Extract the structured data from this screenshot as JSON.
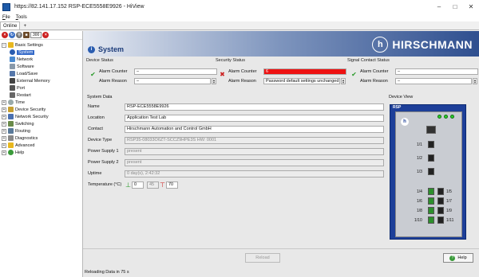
{
  "window": {
    "title": "https://82.141.17.152 RSP-ECE5558E9926 - HiView",
    "min": "–",
    "max": "□",
    "close": "✕"
  },
  "menu": {
    "file_key": "F",
    "file_rest": "ile",
    "tools_key": "T",
    "tools_rest": "ools"
  },
  "tabs": {
    "online": "Online",
    "add": "+"
  },
  "toolbar": {
    "counter": "300"
  },
  "tree": {
    "basic_settings": "Basic Settings",
    "system": "System",
    "network": "Network",
    "software": "Software",
    "load_save": "Load/Save",
    "external_memory": "External Memory",
    "port": "Port",
    "restart": "Restart",
    "time": "Time",
    "device_security": "Device Security",
    "network_security": "Network Security",
    "switching": "Switching",
    "routing": "Routing",
    "diagnostics": "Diagnostics",
    "advanced": "Advanced",
    "help": "Help",
    "expand_plus": "+",
    "expand_minus": "−"
  },
  "header": {
    "title": "System",
    "brand_name": "HIRSCHMANN",
    "brand_logo": "h"
  },
  "device_status": {
    "title": "Device Status",
    "alarm_counter_label": "Alarm Counter",
    "alarm_counter": "–",
    "alarm_reason_label": "Alarm Reason",
    "alarm_reason": "–"
  },
  "security_status": {
    "title": "Security Status",
    "alarm_counter_label": "Alarm Counter",
    "alarm_counter": "6",
    "alarm_reason_label": "Alarm Reason",
    "alarm_reason": "Password default settings unchanged ("
  },
  "signal_status": {
    "title": "Signal Contact Status",
    "alarm_counter_label": "Alarm Counter",
    "alarm_counter": "–",
    "alarm_reason_label": "Alarm Reason",
    "alarm_reason": "–"
  },
  "system_data": {
    "title": "System Data",
    "name_label": "Name",
    "name": "RSP-ECE5558E9926",
    "location_label": "Location",
    "location": "Application Test Lab",
    "contact_label": "Contact",
    "contact": "Hirschmann Automation and Control GmbH",
    "device_type_label": "Device Type",
    "device_type": "RSP35-08033O6ZT-SCCZ9HPE3S HW: 0001",
    "ps1_label": "Power Supply 1",
    "ps1": "present",
    "ps2_label": "Power Supply 2",
    "ps2": "present",
    "uptime_label": "Uptime",
    "uptime": "0 day(s), 2:42:32",
    "temperature_label": "Temperature (°C)",
    "temp_min": "0",
    "temp_current": "45",
    "temp_max": "70"
  },
  "device_view": {
    "title": "Device View",
    "model": "RSP",
    "logo": "h",
    "ports": {
      "p1": "1/1",
      "p2": "1/2",
      "p3": "1/3",
      "p4": "1/4",
      "p5": "1/5",
      "p6": "1/6",
      "p7": "1/7",
      "p8": "1/8",
      "p9": "1/9",
      "p10": "1/10",
      "p11": "1/11"
    }
  },
  "buttons": {
    "reload": "Reload",
    "help": "Help"
  },
  "status_bar": {
    "text": "Reloading Data in 75 s"
  },
  "colors": {
    "alarm_red": "#ee1111",
    "ok_green": "#2a9a2a",
    "brand_blue": "#1d3f99",
    "selected": "#3369c8"
  }
}
